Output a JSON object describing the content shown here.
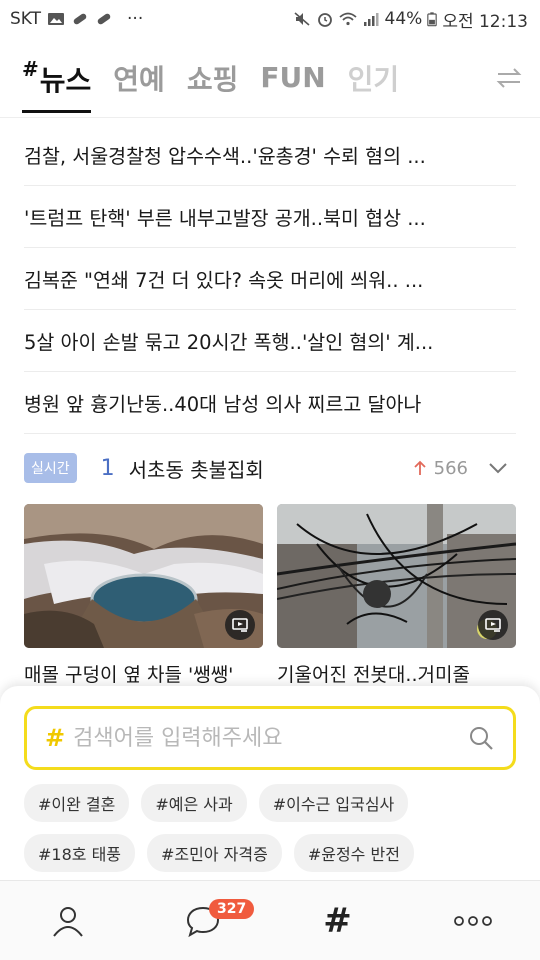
{
  "status_bar": {
    "carrier": "SKT",
    "more": "···",
    "battery": "44%",
    "time": "오전 12:13"
  },
  "tabs": [
    {
      "hash": "#",
      "label": "뉴스",
      "active": true
    },
    {
      "label": "연예"
    },
    {
      "label": "쇼핑"
    },
    {
      "label": "FUN"
    },
    {
      "label": "인기"
    }
  ],
  "news": [
    "검찰, 서울경찰청 압수수색..'윤총경' 수뢰 혐의 ...",
    "'트럼프 탄핵' 부른 내부고발장 공개..북미 협상 ...",
    "김복준 \"연쇄 7건 더 있다? 속옷 머리에 씌워.. ...",
    "5살 아이 손발 묶고 20시간 폭행..'살인 혐의' 계...",
    "병원 앞 흉기난동..40대 남성 의사 찌르고 달아나"
  ],
  "realtime": {
    "badge": "실시간",
    "rank": "1",
    "title": "서초동 촛불집회",
    "count": "566"
  },
  "cards": [
    {
      "title": "매몰 구덩이 옆 차들 '쌩쌩'"
    },
    {
      "title": "기울어진 전봇대..거미줄"
    }
  ],
  "search": {
    "hash": "#",
    "placeholder": "검색어를 입력해주세요"
  },
  "chips": [
    "#이완 결혼",
    "#예은 사과",
    "#이수근 입국심사",
    "#18호 태풍",
    "#조민아 자격증",
    "#윤정수 반전"
  ],
  "bottom_nav": {
    "chat_badge": "327",
    "hash": "#"
  },
  "colors": {
    "search_border": "#f4dc1c",
    "realtime_badge": "#a8bde8",
    "rank": "#4b6fc4",
    "chat_badge": "#f05b3e"
  }
}
